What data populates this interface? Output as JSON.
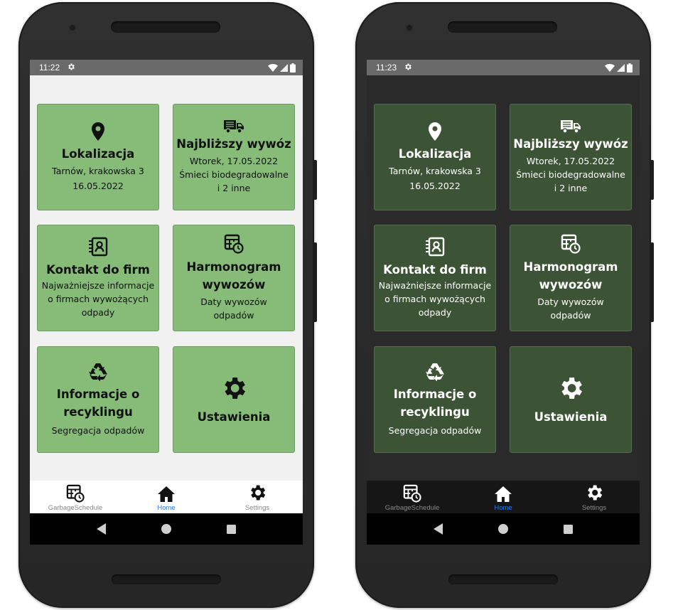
{
  "screens": [
    {
      "theme": "light",
      "status_time": "11:22",
      "cards": {
        "location": {
          "title": "Lokalizacja",
          "line1": "Tarnów, krakowska 3",
          "line2": "16.05.2022"
        },
        "next_pickup": {
          "title": "Najbliższy wywóz",
          "line1": "Wtorek, 17.05.2022",
          "line2": "Śmieci biodegradowalne",
          "line3": "i 2 inne"
        },
        "contact": {
          "title": "Kontakt do firm",
          "line1": "Najważniejsze informacje",
          "line2": "o firmach wywożących",
          "line3": "odpady"
        },
        "schedule": {
          "title1": "Harmonogram",
          "title2": "wywozów",
          "line1": "Daty wywozów",
          "line2": "odpadów"
        },
        "recycling": {
          "title1": "Informacje o",
          "title2": "recyklingu",
          "line1": "Segregacja odpadów"
        },
        "settings": {
          "title": "Ustawienia"
        }
      },
      "tabs": {
        "schedule": "GarbageSchedule",
        "home": "Home",
        "settings": "Settings"
      }
    },
    {
      "theme": "dark",
      "status_time": "11:23",
      "cards": {
        "location": {
          "title": "Lokalizacja",
          "line1": "Tarnów, krakowska 3",
          "line2": "16.05.2022"
        },
        "next_pickup": {
          "title": "Najbliższy wywóz",
          "line1": "Wtorek, 17.05.2022",
          "line2": "Śmieci biodegradowalne",
          "line3": "i 2 inne"
        },
        "contact": {
          "title": "Kontakt do firm",
          "line1": "Najważniejsze informacje",
          "line2": "o firmach wywożących",
          "line3": "odpady"
        },
        "schedule": {
          "title1": "Harmonogram",
          "title2": "wywozów",
          "line1": "Daty wywozów",
          "line2": "odpadów"
        },
        "recycling": {
          "title1": "Informacje o",
          "title2": "recyklingu",
          "line1": "Segregacja odpadów"
        },
        "settings": {
          "title": "Ustawienia"
        }
      },
      "tabs": {
        "schedule": "GarbageSchedule",
        "home": "Home",
        "settings": "Settings"
      }
    }
  ],
  "colors": {
    "light_card": "#86bb78",
    "dark_card": "#3c5435",
    "active_tab": "#2b7be6"
  },
  "icons": [
    "map-pin-icon",
    "truck-icon",
    "contact-card-icon",
    "calendar-clock-icon",
    "recycle-icon",
    "gear-icon",
    "home-icon",
    "wifi-icon",
    "signal-icon",
    "battery-icon",
    "back-icon",
    "home-circle-icon",
    "recents-icon"
  ]
}
